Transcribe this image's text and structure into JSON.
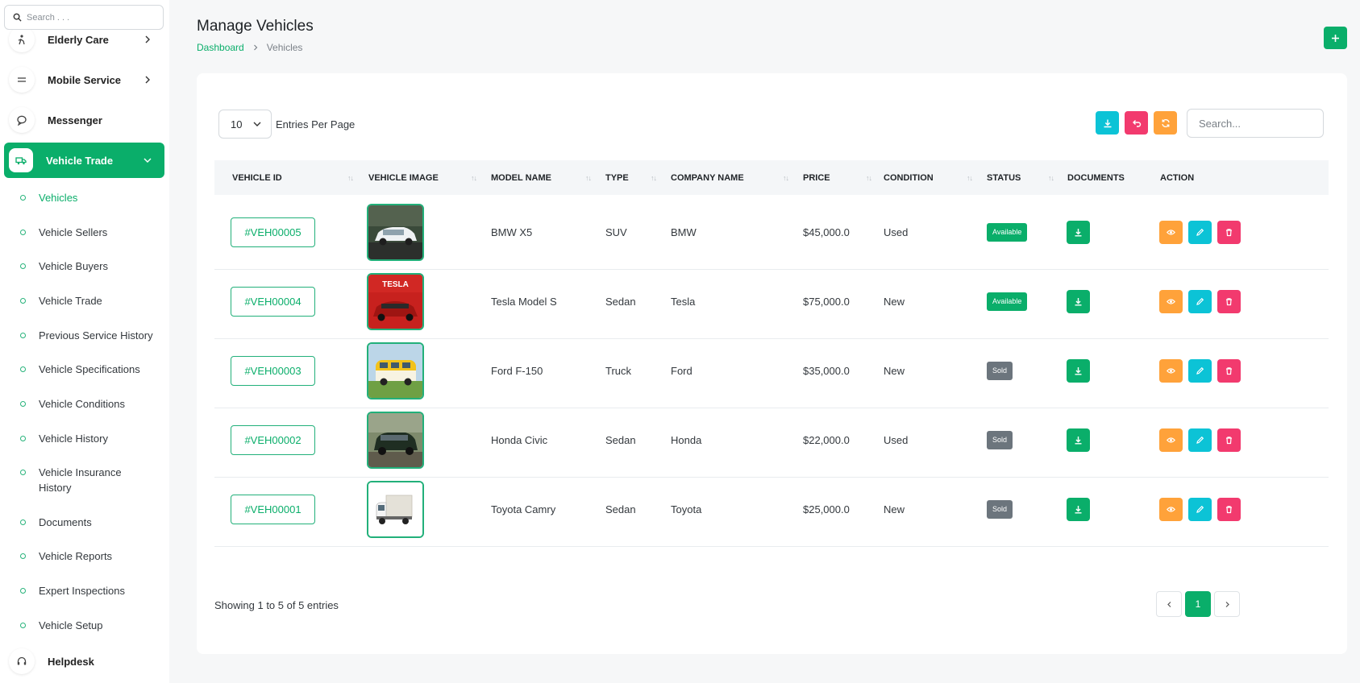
{
  "sidebar": {
    "search_placeholder": "Search . . .",
    "menu": [
      {
        "label": "Elderly Care"
      },
      {
        "label": "Mobile Service"
      },
      {
        "label": "Messenger"
      },
      {
        "label": "Vehicle Trade"
      }
    ],
    "submenu": [
      {
        "label": "Vehicles"
      },
      {
        "label": "Vehicle Sellers"
      },
      {
        "label": "Vehicle Buyers"
      },
      {
        "label": "Vehicle Trade"
      },
      {
        "label": "Previous Service History"
      },
      {
        "label": "Vehicle Specifications"
      },
      {
        "label": "Vehicle Conditions"
      },
      {
        "label": "Vehicle History"
      },
      {
        "label": "Vehicle Insurance History"
      },
      {
        "label": "Documents"
      },
      {
        "label": "Vehicle Reports"
      },
      {
        "label": "Expert Inspections"
      },
      {
        "label": "Vehicle Setup"
      }
    ],
    "helpdesk_label": "Helpdesk"
  },
  "header": {
    "title": "Manage Vehicles",
    "breadcrumb": {
      "home": "Dashboard",
      "current": "Vehicles"
    }
  },
  "toolbar": {
    "entries_value": "10",
    "entries_label": "Entries Per Page",
    "search_placeholder": "Search..."
  },
  "table": {
    "columns": [
      "Vehicle ID",
      "Vehicle Image",
      "Model Name",
      "Type",
      "Company Name",
      "Price",
      "Condition",
      "Status",
      "Documents",
      "Action"
    ],
    "rows": [
      {
        "id": "#VEH00005",
        "image": "white-suv-photo",
        "model": "BMW X5",
        "type": "SUV",
        "company": "BMW",
        "price": "$45,000.0",
        "condition": "Used",
        "status": "Available"
      },
      {
        "id": "#VEH00004",
        "image": "red-tesla-photo",
        "model": "Tesla Model S",
        "type": "Sedan",
        "company": "Tesla",
        "price": "$75,000.0",
        "condition": "New",
        "status": "Available"
      },
      {
        "id": "#VEH00003",
        "image": "yellow-van-photo",
        "model": "Ford F-150",
        "type": "Truck",
        "company": "Ford",
        "price": "$35,000.0",
        "condition": "New",
        "status": "Sold"
      },
      {
        "id": "#VEH00002",
        "image": "green-suv-photo",
        "model": "Honda Civic",
        "type": "Sedan",
        "company": "Honda",
        "price": "$22,000.0",
        "condition": "Used",
        "status": "Sold"
      },
      {
        "id": "#VEH00001",
        "image": "box-truck-photo",
        "model": "Toyota Camry",
        "type": "Sedan",
        "company": "Toyota",
        "price": "$25,000.0",
        "condition": "New",
        "status": "Sold"
      }
    ]
  },
  "footer": {
    "showing": "Showing 1 to 5 of 5 entries",
    "current_page": "1"
  },
  "colors": {
    "primary": "#0aae6a",
    "cyan": "#0cc3d6",
    "pink": "#f23a6e",
    "orange": "#ffa23a",
    "available": "#0aae6a",
    "sold": "#6c757d"
  }
}
